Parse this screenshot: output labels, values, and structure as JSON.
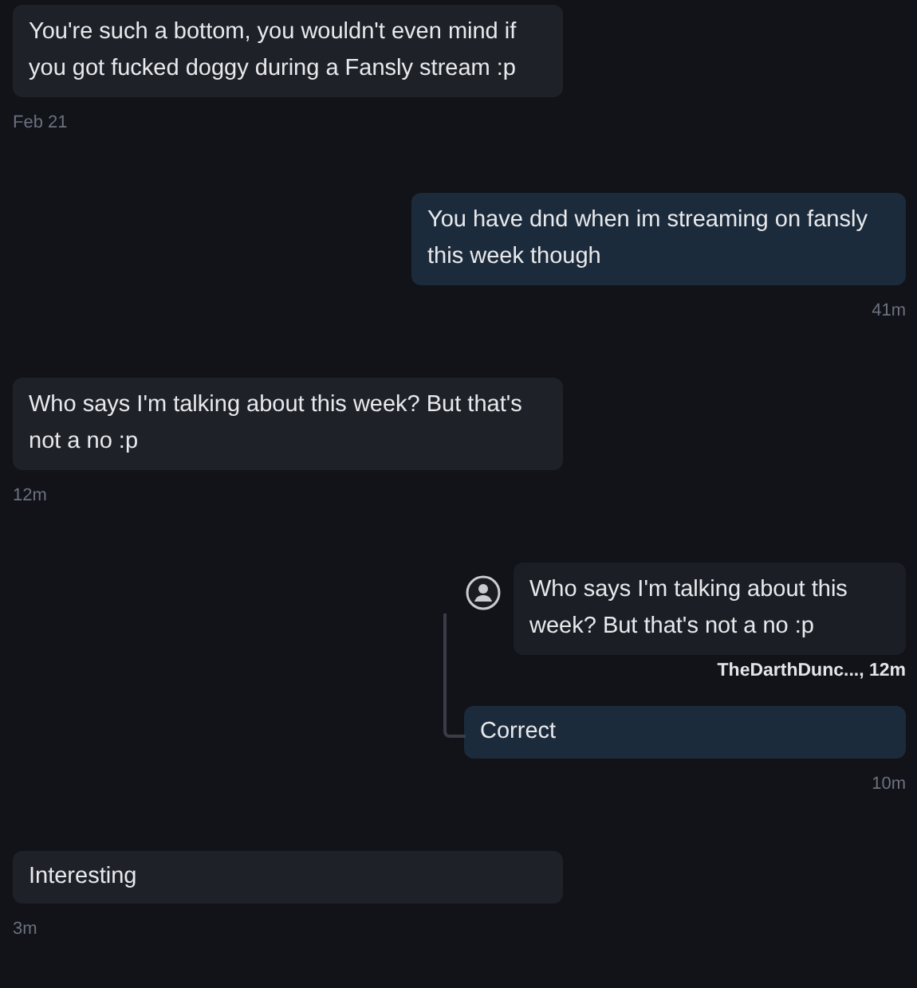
{
  "messages": [
    {
      "kind": "received",
      "text": "You're such a bottom, you wouldn't even mind if you got fucked doggy during a Fansly stream :p",
      "time": "Feb 21"
    },
    {
      "kind": "sent",
      "text": "You have dnd when im streaming on fansly this week though",
      "time": "41m"
    },
    {
      "kind": "received",
      "text": "Who says I'm talking about this week? But that's not a no :p",
      "time": "12m"
    },
    {
      "kind": "sent",
      "text": "Correct",
      "time": "10m",
      "reply": {
        "text": "Who says I'm talking about this week? But that's not a no :p",
        "caption": "TheDarthDunc..., 12m"
      }
    },
    {
      "kind": "received",
      "text": "Interesting",
      "time": "3m"
    }
  ]
}
